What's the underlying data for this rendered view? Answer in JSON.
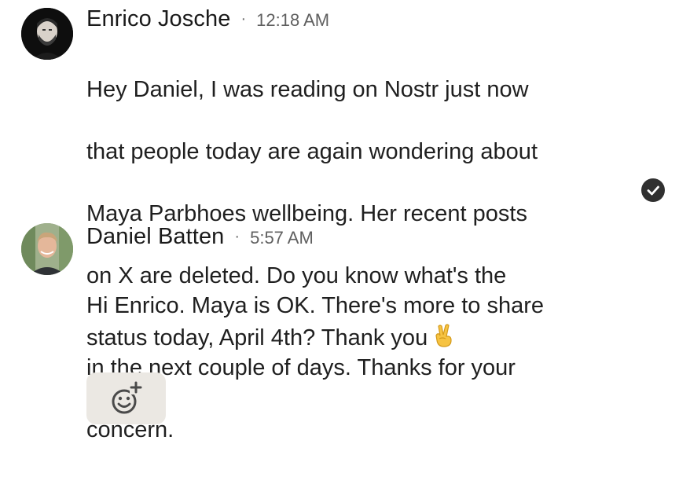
{
  "messages": [
    {
      "author": "Enrico Josche",
      "separator": "·",
      "time": "12:18 AM",
      "lines": [
        "Hey Daniel, I was reading on Nostr just now",
        "that people today are again wondering about",
        "Maya Parbhoes wellbeing. Her recent posts",
        "on X are deleted. Do you know what's the",
        "status today, April 4th? Thank you"
      ],
      "emoji": "victory-hand-icon",
      "status_icon": "read-check-icon"
    },
    {
      "author": "Daniel Batten",
      "separator": "·",
      "time": "5:57 AM",
      "lines": [
        "Hi Enrico. Maya is OK. There's more to share",
        "in the next couple of days. Thanks for your",
        "concern."
      ]
    }
  ],
  "reaction_button": {
    "icon": "add-reaction-icon"
  },
  "colors": {
    "background": "#ffffff",
    "text": "#1f1f1f",
    "secondary": "#5f5f5f",
    "check_bg": "#303030",
    "reaction_bg": "#ebe8e3"
  }
}
